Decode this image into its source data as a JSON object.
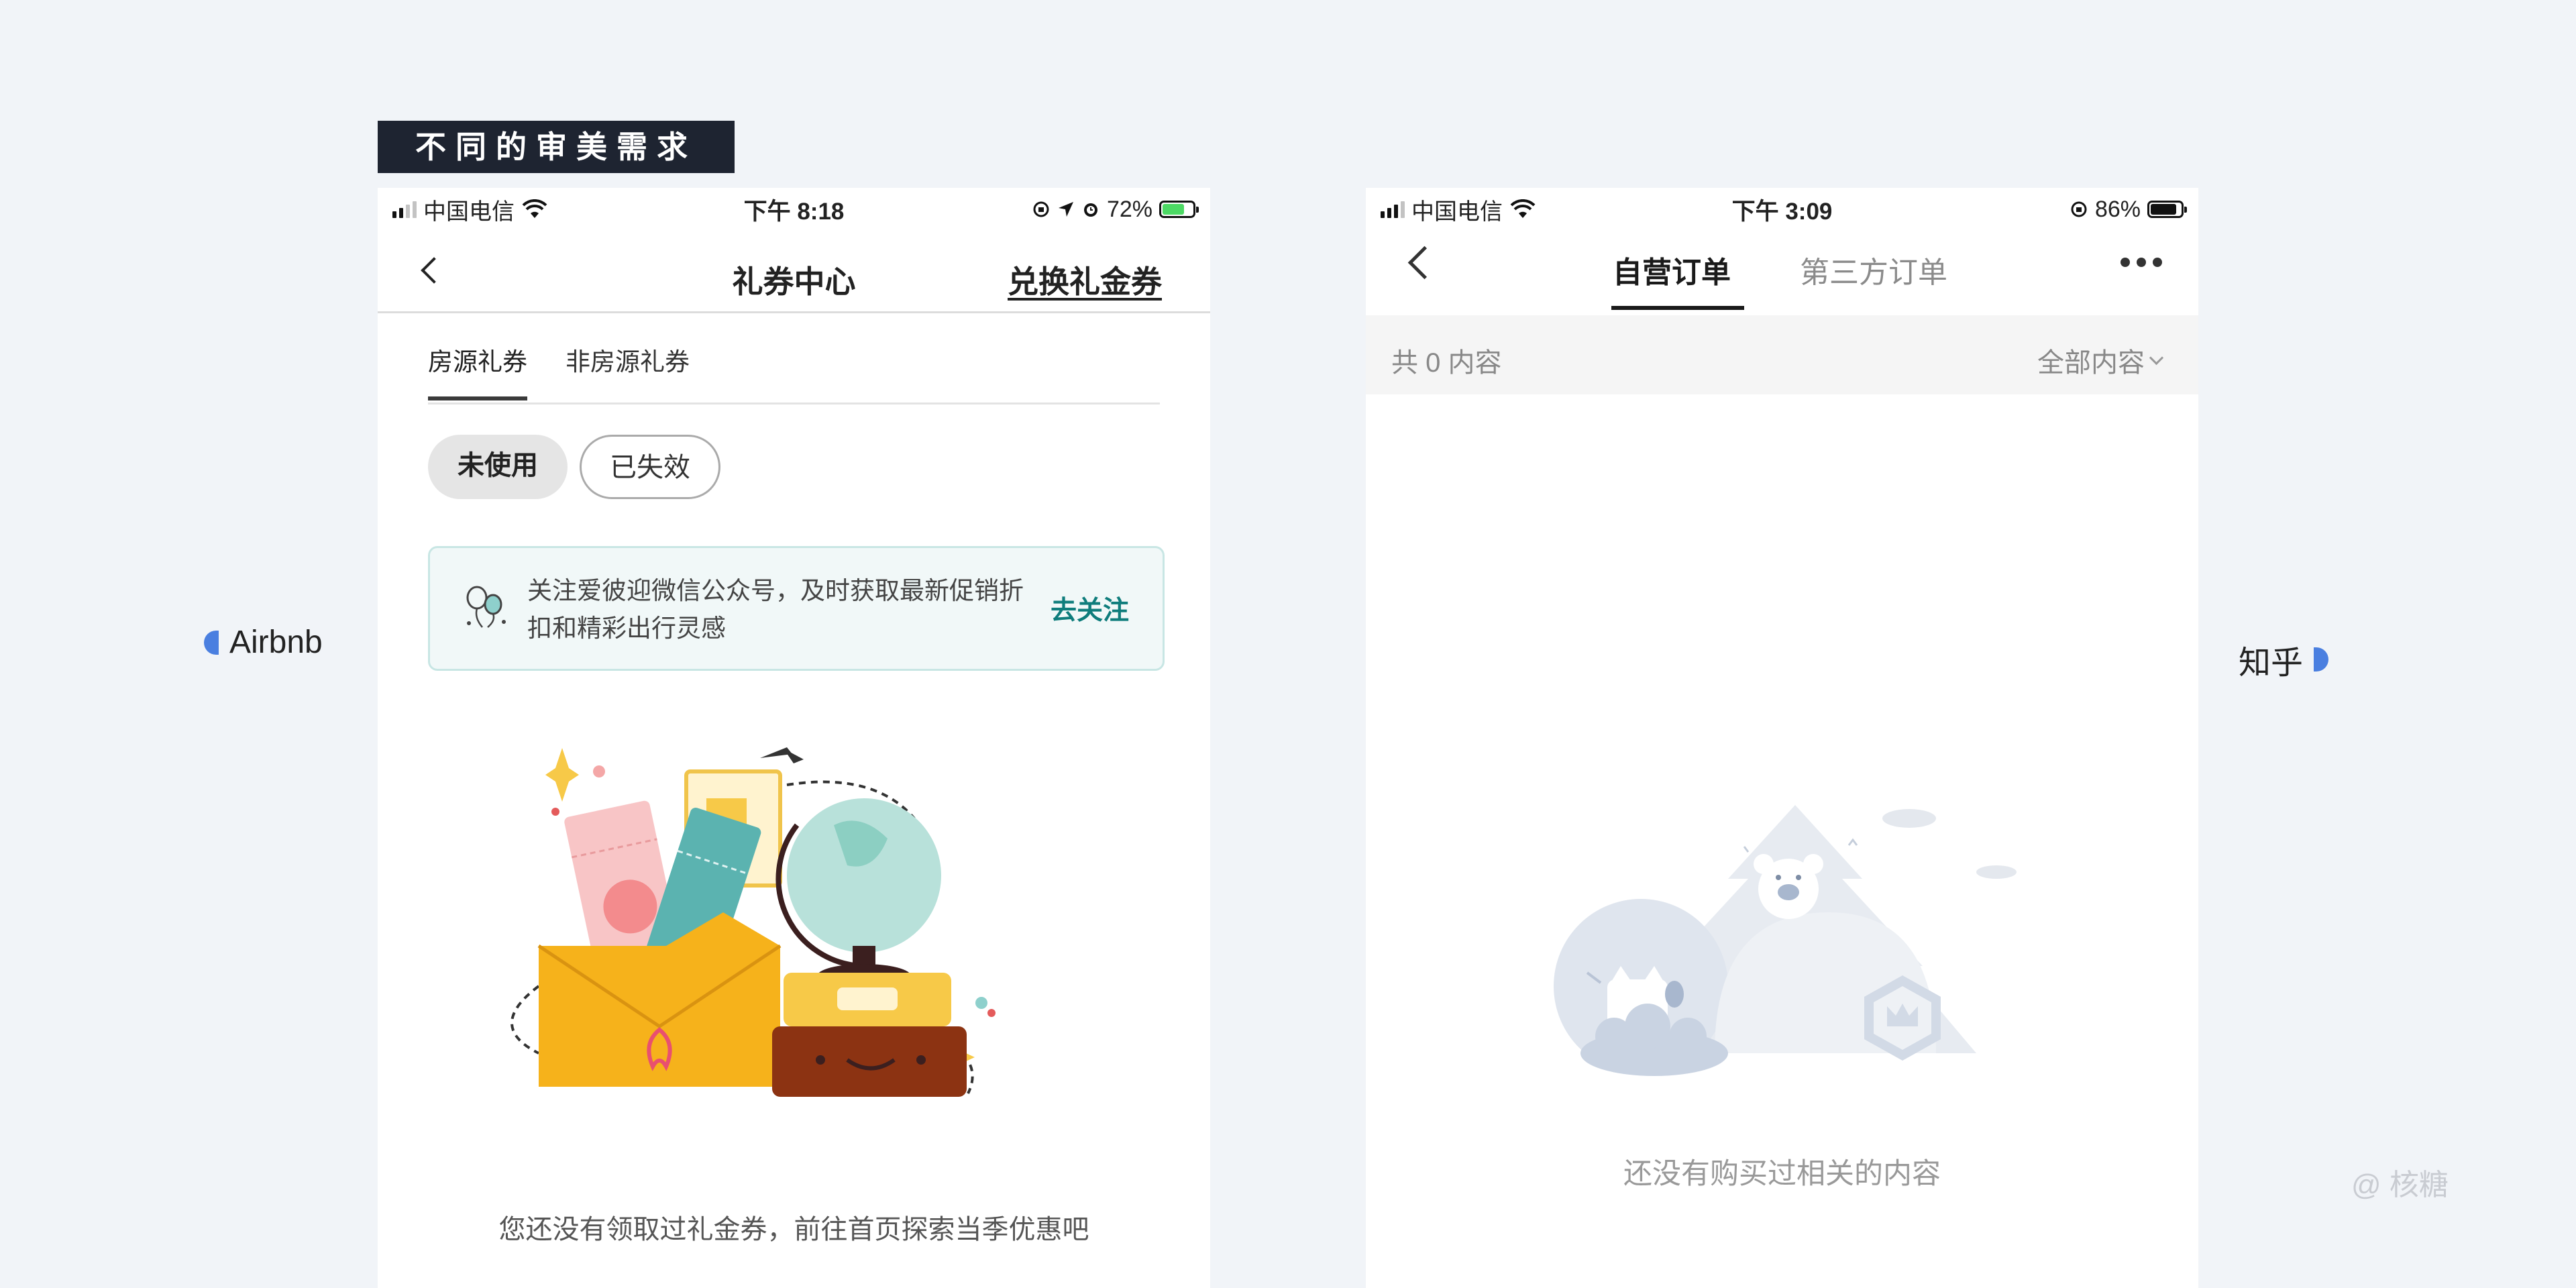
{
  "headline": "不同的审美需求",
  "labels": {
    "left": "Airbnb",
    "right": "知乎"
  },
  "watermark": "@ 核糖",
  "airbnb": {
    "status": {
      "carrier": "中国电信",
      "time": "下午 8:18",
      "battery": "72%",
      "battery_fraction": 0.72,
      "battery_color": "#4cd964"
    },
    "nav": {
      "title": "礼券中心",
      "action": "兑换礼金券"
    },
    "tabs": [
      {
        "label": "房源礼券",
        "active": true
      },
      {
        "label": "非房源礼券",
        "active": false
      }
    ],
    "filters": [
      {
        "label": "未使用",
        "active": true
      },
      {
        "label": "已失效",
        "active": false
      }
    ],
    "banner": {
      "text": "关注爱彼迎微信公众号，及时获取最新促销折扣和精彩出行灵感",
      "cta": "去关注",
      "cta_color": "#0f7d7c"
    },
    "empty_text": "您还没有领取过礼金券，前往首页探索当季优惠吧"
  },
  "zhihu": {
    "status": {
      "carrier": "中国电信",
      "time": "下午 3:09",
      "battery": "86%",
      "battery_fraction": 0.86,
      "battery_color": "#111111"
    },
    "tabs": [
      {
        "label": "自营订单",
        "active": true
      },
      {
        "label": "第三方订单",
        "active": false
      }
    ],
    "count_label": "共 0 内容",
    "filter_label": "全部内容",
    "empty_text": "还没有购买过相关的内容"
  },
  "colors": {
    "background": "#f1f4f8",
    "tag_bg": "#1e2431",
    "accent_blue": "#4a7fe0",
    "airbnb_teal": "#0f7d7c"
  }
}
